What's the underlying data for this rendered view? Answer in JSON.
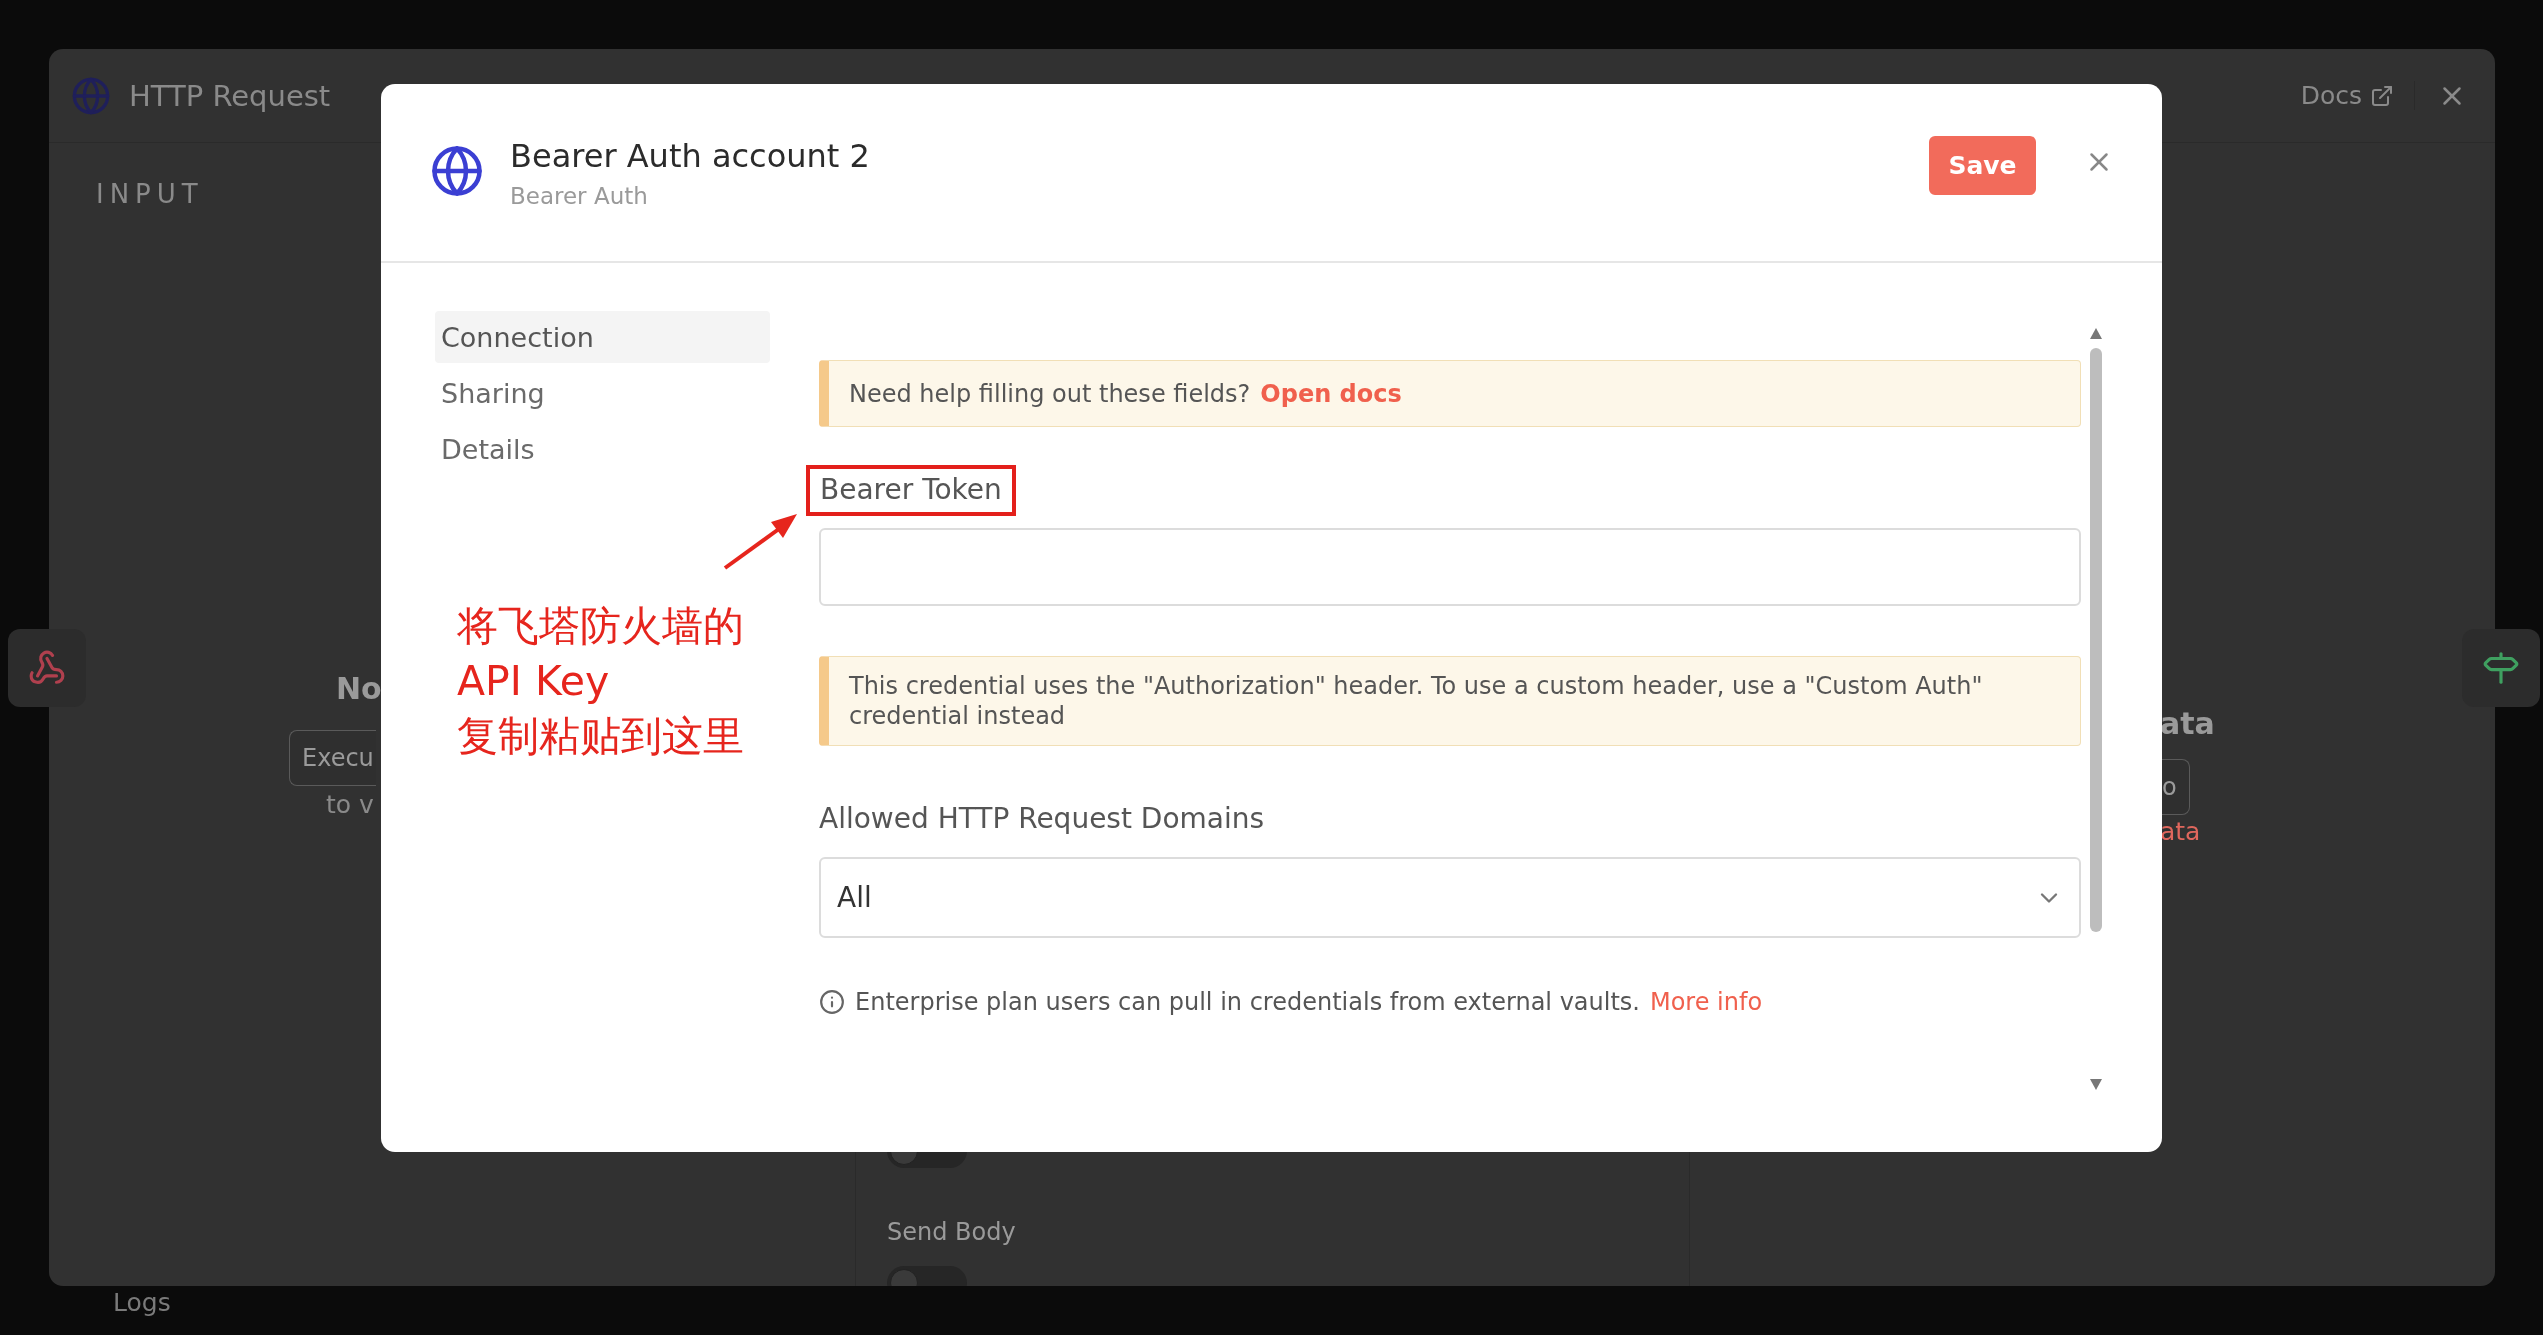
{
  "app_window": {
    "title": "HTTP Request",
    "docs_link": "Docs",
    "input_heading": "INPUT",
    "input_panel": {
      "heading": "No",
      "button": "Execu",
      "hint": "to v"
    },
    "parameters": [
      {
        "kind": "toggle",
        "on": false
      },
      {
        "kind": "toggle",
        "label": "Send Body",
        "on": false
      }
    ],
    "output_panel": {
      "heading": "ata",
      "button": "o",
      "link": "ata"
    },
    "footer": "Logs"
  },
  "modal": {
    "title": "Bearer Auth account 2",
    "subtitle": "Bearer Auth",
    "save_button": "Save",
    "nav": [
      {
        "label": "Connection",
        "selected": true
      },
      {
        "label": "Sharing",
        "selected": false
      },
      {
        "label": "Details",
        "selected": false
      }
    ],
    "help_notice": {
      "text": "Need help filling out these fields?",
      "link": "Open docs"
    },
    "token_field": {
      "label": "Bearer Token",
      "highlighted": true
    },
    "header_notice": "This credential uses the \"Authorization\" header. To use a custom header, use a \"Custom Auth\" credential instead",
    "domains_field": {
      "label": "Allowed HTTP Request Domains",
      "value": "All"
    },
    "info_line": {
      "text": "Enterprise plan users can pull in credentials from external vaults.",
      "link": "More info"
    }
  },
  "annotation": {
    "lines": [
      "将飞塔防火墙的",
      "API Key",
      "复制粘贴到这里"
    ]
  }
}
